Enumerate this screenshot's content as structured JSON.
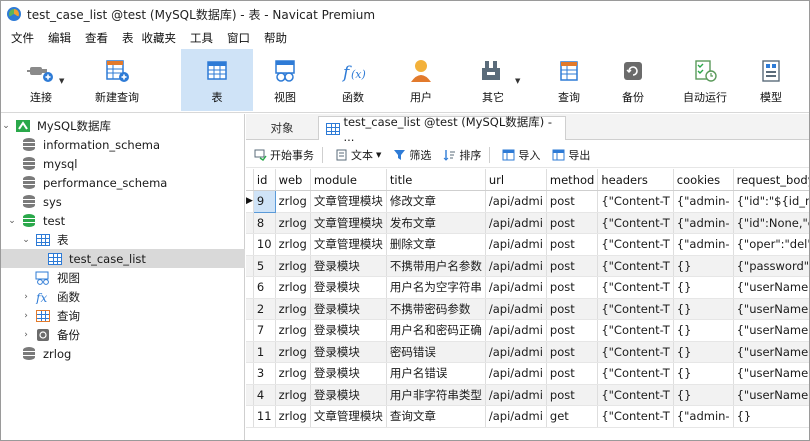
{
  "window": {
    "title": "test_case_list @test (MySQL数据库) - 表 - Navicat Premium"
  },
  "menu": [
    "文件",
    "编辑",
    "查看",
    "表",
    "收藏夹",
    "工具",
    "窗口",
    "帮助"
  ],
  "toolbar": {
    "buttons": [
      {
        "label": "连接",
        "icon": "plug-connect-icon"
      },
      {
        "label": "新建查询",
        "icon": "new-query-icon"
      },
      {
        "label": "表",
        "icon": "table-icon",
        "active": true
      },
      {
        "label": "视图",
        "icon": "view-icon"
      },
      {
        "label": "函数",
        "icon": "function-icon"
      },
      {
        "label": "用户",
        "icon": "user-icon"
      },
      {
        "label": "其它",
        "icon": "tools-icon"
      },
      {
        "label": "查询",
        "icon": "query-icon"
      },
      {
        "label": "备份",
        "icon": "backup-icon"
      },
      {
        "label": "自动运行",
        "icon": "schedule-icon"
      },
      {
        "label": "模型",
        "icon": "model-icon"
      }
    ]
  },
  "sidebar": {
    "connection": "MySQL数据库",
    "databases": [
      "information_schema",
      "mysql",
      "performance_schema",
      "sys",
      "test"
    ],
    "test_children": {
      "tables_label": "表",
      "tables": [
        "test_case_list"
      ],
      "views_label": "视图",
      "functions_label": "函数",
      "queries_label": "查询",
      "backups_label": "备份"
    },
    "other_db": "zrlog"
  },
  "tabs": {
    "objects": "对象",
    "active": "test_case_list @test (MySQL数据库) - ..."
  },
  "subtoolbar": {
    "begin_transaction": "开始事务",
    "text": "文本",
    "filter": "筛选",
    "sort": "排序",
    "import": "导入",
    "export": "导出"
  },
  "grid": {
    "columns": [
      "id",
      "web",
      "module",
      "title",
      "url",
      "method",
      "headers",
      "cookies",
      "request_body"
    ],
    "rows": [
      [
        "9",
        "zrlog",
        "文章管理模块",
        "修改文章",
        "/api/admi",
        "post",
        "{\"Content-T",
        "{\"admin-",
        "{\"id\":\"${id_name"
      ],
      [
        "8",
        "zrlog",
        "文章管理模块",
        "发布文章",
        "/api/admi",
        "post",
        "{\"Content-T",
        "{\"admin-",
        "{\"id\":None,\"edito"
      ],
      [
        "10",
        "zrlog",
        "文章管理模块",
        "删除文章",
        "/api/admi",
        "post",
        "{\"Content-T",
        "{\"admin-",
        "{\"oper\":\"del\",\"id"
      ],
      [
        "5",
        "zrlog",
        "登录模块",
        "不携带用户名参数",
        "/api/admi",
        "post",
        "{\"Content-T",
        "{}",
        "{\"password\":\"ca"
      ],
      [
        "6",
        "zrlog",
        "登录模块",
        "用户名为空字符串",
        "/api/admi",
        "post",
        "{\"Content-T",
        "{}",
        "{\"userName\":\"\","
      ],
      [
        "2",
        "zrlog",
        "登录模块",
        "不携带密码参数",
        "/api/admi",
        "post",
        "{\"Content-T",
        "{}",
        "{\"userName\":\"ad"
      ],
      [
        "7",
        "zrlog",
        "登录模块",
        "用户名和密码正确",
        "/api/admi",
        "post",
        "{\"Content-T",
        "{}",
        "{\"userName\":\"ad"
      ],
      [
        "1",
        "zrlog",
        "登录模块",
        "密码错误",
        "/api/admi",
        "post",
        "{\"Content-T",
        "{}",
        "{\"userName\":\"ad"
      ],
      [
        "3",
        "zrlog",
        "登录模块",
        "用户名错误",
        "/api/admi",
        "post",
        "{\"Content-T",
        "{}",
        "{\"userName\":\"ad"
      ],
      [
        "4",
        "zrlog",
        "登录模块",
        "用户非字符串类型",
        "/api/admi",
        "post",
        "{\"Content-T",
        "{}",
        "{\"userName\":12"
      ],
      [
        "11",
        "zrlog",
        "文章管理模块",
        "查询文章",
        "/api/admi",
        "get",
        "{\"Content-T",
        "{\"admin-",
        "{}"
      ]
    ]
  },
  "colors": {
    "accent": "#2e7bd6",
    "active_toolbar": "#cfe3f7",
    "selected_tree": "#d9d9d9",
    "green": "#2aa84a"
  }
}
